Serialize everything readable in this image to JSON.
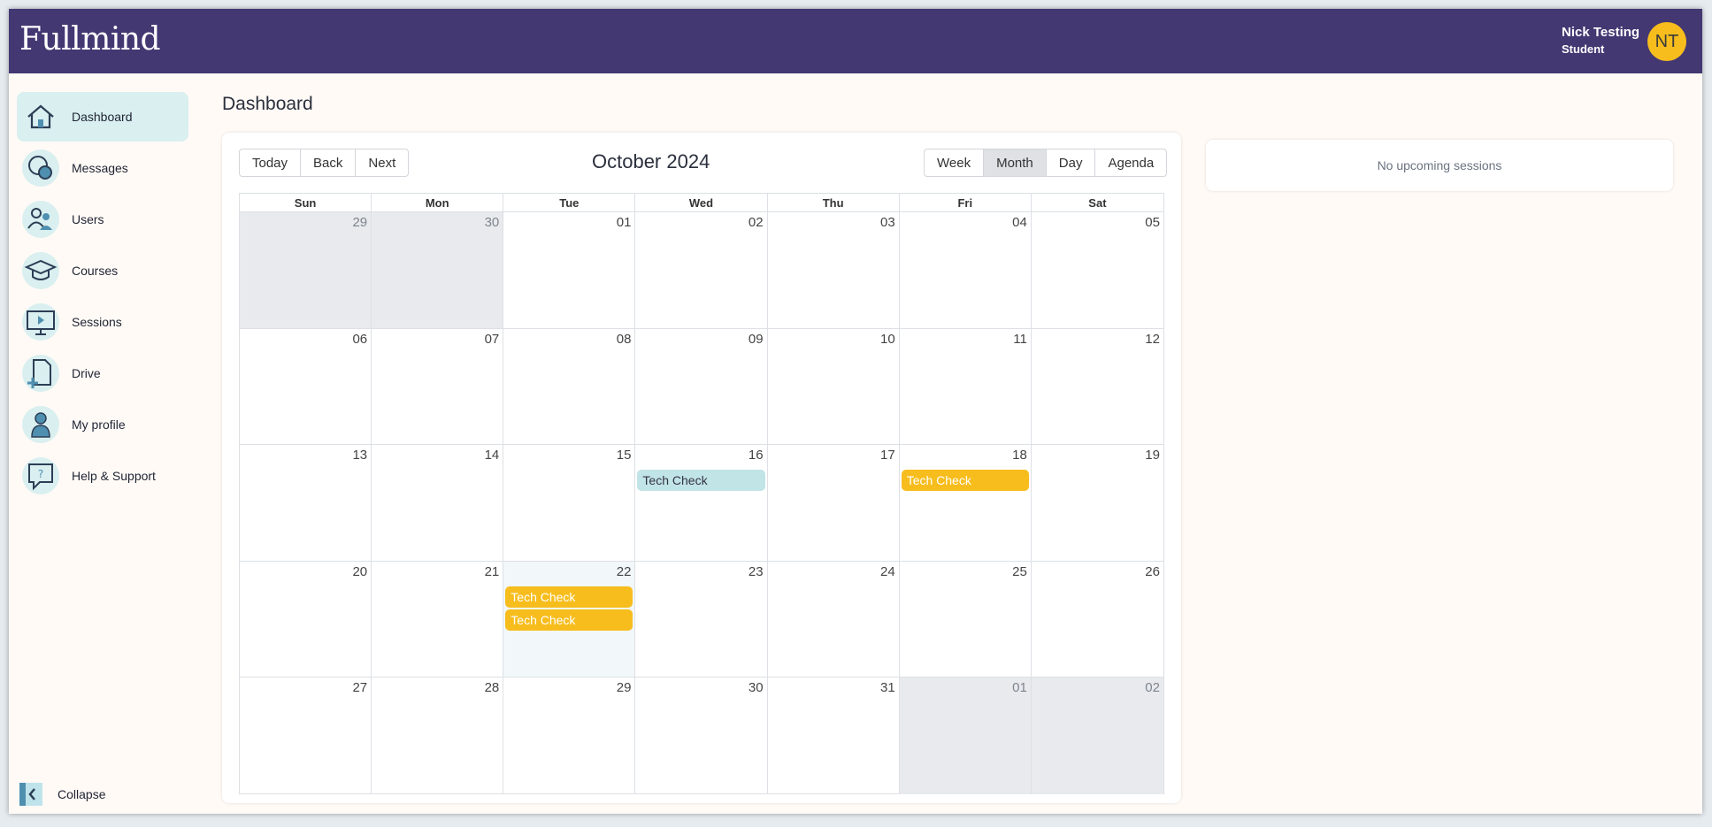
{
  "brand": {
    "logo_text": "Fullmind"
  },
  "user": {
    "name": "Nick Testing",
    "role": "Student",
    "initials": "NT"
  },
  "sidebar": {
    "items": [
      {
        "label": "Dashboard",
        "icon": "home-icon",
        "active": true
      },
      {
        "label": "Messages",
        "icon": "chat-bubbles-icon"
      },
      {
        "label": "Users",
        "icon": "users-icon"
      },
      {
        "label": "Courses",
        "icon": "graduation-cap-icon"
      },
      {
        "label": "Sessions",
        "icon": "monitor-play-icon"
      },
      {
        "label": "Drive",
        "icon": "file-add-icon"
      },
      {
        "label": "My profile",
        "icon": "person-icon"
      },
      {
        "label": "Help & Support",
        "icon": "help-bubble-icon"
      }
    ],
    "collapse_label": "Collapse"
  },
  "page": {
    "title": "Dashboard"
  },
  "calendar": {
    "title": "October 2024",
    "nav_buttons": [
      "Today",
      "Back",
      "Next"
    ],
    "view_buttons": [
      "Week",
      "Month",
      "Day",
      "Agenda"
    ],
    "active_view": "Month",
    "weekdays": [
      "Sun",
      "Mon",
      "Tue",
      "Wed",
      "Thu",
      "Fri",
      "Sat"
    ],
    "weeks": [
      [
        "29",
        "30",
        "01",
        "02",
        "03",
        "04",
        "05"
      ],
      [
        "06",
        "07",
        "08",
        "09",
        "10",
        "11",
        "12"
      ],
      [
        "13",
        "14",
        "15",
        "16",
        "17",
        "18",
        "19"
      ],
      [
        "20",
        "21",
        "22",
        "23",
        "24",
        "25",
        "26"
      ],
      [
        "27",
        "28",
        "29",
        "30",
        "31",
        "01",
        "02"
      ]
    ],
    "outside_month": [
      [
        0,
        0
      ],
      [
        0,
        1
      ],
      [
        4,
        5
      ],
      [
        4,
        6
      ]
    ],
    "today": [
      3,
      2
    ],
    "events": [
      {
        "week": 2,
        "day": 3,
        "title": "Tech Check",
        "color": "teal"
      },
      {
        "week": 2,
        "day": 5,
        "title": "Tech Check",
        "color": "yellow"
      },
      {
        "week": 3,
        "day": 2,
        "title": "Tech Check",
        "color": "yellow"
      },
      {
        "week": 3,
        "day": 2,
        "title": "Tech Check",
        "color": "yellow"
      }
    ]
  },
  "upcoming": {
    "empty_text": "No upcoming sessions"
  },
  "colors": {
    "topbar": "#433872",
    "accent_yellow": "#f7bd1d",
    "accent_teal": "#c1e4e6",
    "active_nav": "#d9eff0"
  }
}
